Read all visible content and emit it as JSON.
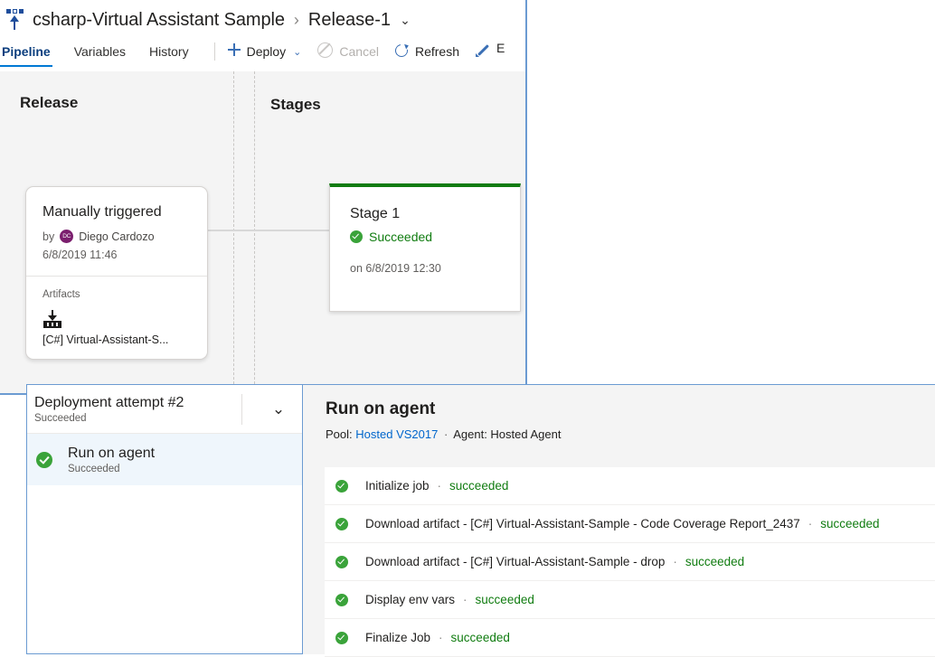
{
  "header": {
    "icon": "releases-rocket-icon",
    "project_title": "csharp-Virtual Assistant Sample",
    "separator": "›",
    "release_name": "Release-1",
    "release_chevron": "⌄"
  },
  "tabs": [
    {
      "label": "Pipeline",
      "active": true
    },
    {
      "label": "Variables",
      "active": false
    },
    {
      "label": "History",
      "active": false
    }
  ],
  "toolbar": {
    "deploy_label": "Deploy",
    "deploy_caret": "⌄",
    "cancel_label": "Cancel",
    "refresh_label": "Refresh",
    "edit_label_truncated": "E"
  },
  "canvas": {
    "release_column_title": "Release",
    "stages_column_title": "Stages",
    "release_card": {
      "trigger": "Manually triggered",
      "by_label": "by",
      "author": "Diego Cardozo",
      "author_initials": "DC",
      "timestamp": "6/8/2019 11:46",
      "artifacts_label": "Artifacts",
      "artifact_icon": "build-artifact-icon",
      "artifact_name": "[C#] Virtual-Assistant-S..."
    },
    "stage_card": {
      "name": "Stage 1",
      "status": "Succeeded",
      "status_color": "#107c10",
      "when": "on 6/8/2019 12:30",
      "top_bar_color": "#107c10"
    }
  },
  "phase_panel": {
    "attempt_title": "Deployment attempt #2",
    "attempt_status": "Succeeded",
    "collapse_caret": "⌄",
    "items": [
      {
        "title": "Run on agent",
        "status": "Succeeded",
        "selected": true
      }
    ]
  },
  "job_panel": {
    "title": "Run on agent",
    "pool_label": "Pool:",
    "pool_value": "Hosted VS2017",
    "meta_dot": "·",
    "agent_label": "Agent: Hosted Agent",
    "tasks": [
      {
        "name": "Initialize job",
        "status": "succeeded"
      },
      {
        "name": "Download artifact - [C#] Virtual-Assistant-Sample - Code Coverage Report_2437",
        "status": "succeeded"
      },
      {
        "name": "Download artifact - [C#] Virtual-Assistant-Sample - drop",
        "status": "succeeded"
      },
      {
        "name": "Display env vars",
        "status": "succeeded"
      },
      {
        "name": "Finalize Job",
        "status": "succeeded"
      }
    ],
    "task_separator": "·"
  },
  "colors": {
    "accent": "#0078d4",
    "success": "#107c10",
    "link": "#0066cc",
    "canvas_bg": "#f4f4f4",
    "selection_bg": "#eff6fc",
    "panel_border": "#6b9bd2"
  }
}
